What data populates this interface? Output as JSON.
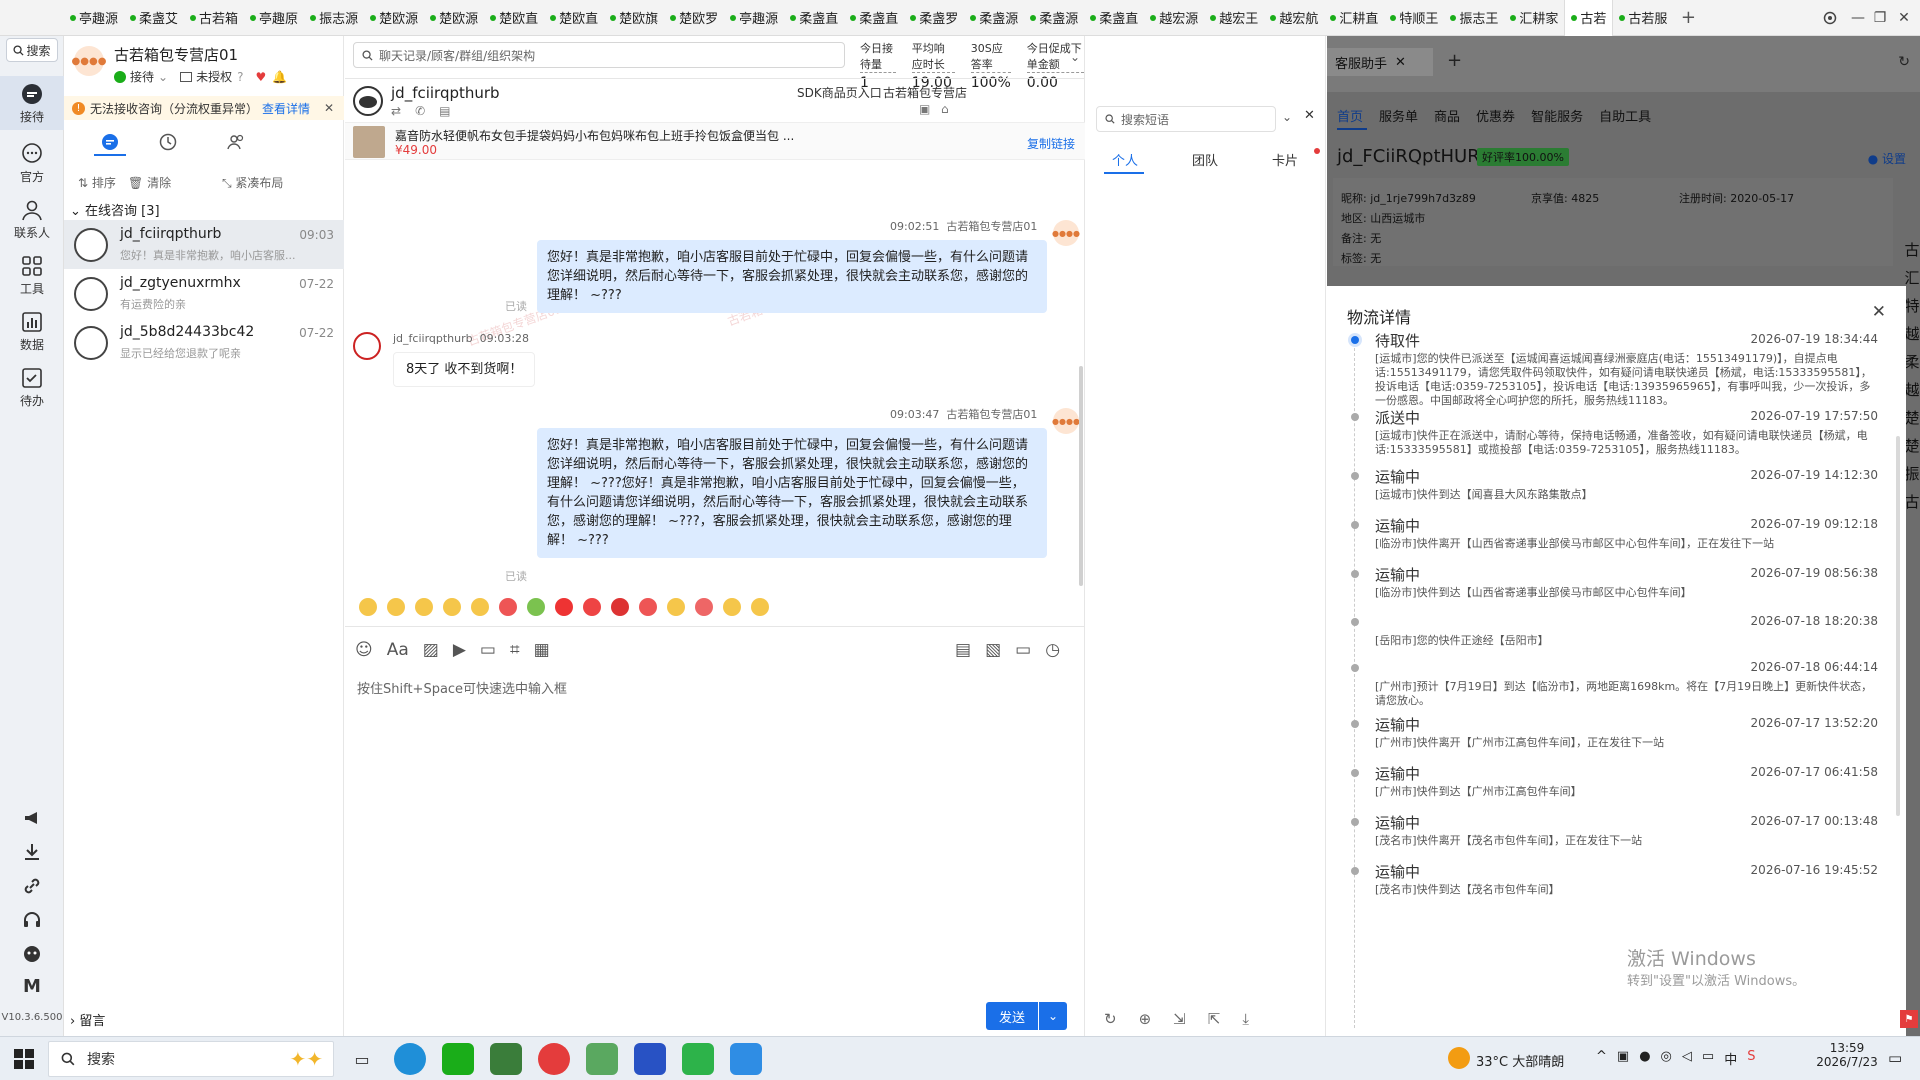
{
  "tabs": [
    "亭趣源",
    "柔盏艾",
    "古若箱",
    "亭趣原",
    "振志源",
    "楚欧源",
    "楚欧源",
    "楚欧直",
    "楚欧直",
    "楚欧旗",
    "楚欧罗",
    "亭趣源",
    "柔盏直",
    "柔盏直",
    "柔盏罗",
    "柔盏源",
    "柔盏源",
    "柔盏直",
    "越宏源",
    "越宏王",
    "越宏航",
    "汇耕直",
    "特顺王",
    "振志王",
    "汇耕家",
    "古若",
    "古若服"
  ],
  "active_tab_index": 25,
  "rail": {
    "search": "搜索",
    "items": [
      "接待",
      "官方",
      "联系人",
      "工具",
      "数据",
      "待办"
    ],
    "version": "V10.3.6.500",
    "bottom_letter": "M"
  },
  "shop": {
    "name": "古若箱包专营店01",
    "status": "接待",
    "auth": "未授权"
  },
  "warning": {
    "text": "无法接收咨询（分流权重异常）",
    "link": "查看详情"
  },
  "conv_toolbar": {
    "sort": "排序",
    "clear": "清除",
    "layout": "紧凑布局"
  },
  "online_header": "在线咨询 [3]",
  "leave_msg": "留言",
  "conversations": [
    {
      "name": "jd_fciirqpthurb",
      "time": "09:03",
      "preview": "您好！真是非常抱歉，咱小店客服..."
    },
    {
      "name": "jd_zgtyenuxrmhx",
      "time": "07-22",
      "preview": "有运费险的亲"
    },
    {
      "name": "jd_5b8d24433bc42",
      "time": "07-22",
      "preview": "显示已经给您退款了呢亲"
    }
  ],
  "chat": {
    "search_placeholder": "聊天记录/顾客/群组/组织架构",
    "stats": [
      {
        "label": "今日接待量",
        "value": "1"
      },
      {
        "label": "平均响应时长",
        "value": "19.00"
      },
      {
        "label": "30S应答率",
        "value": "100%"
      },
      {
        "label": "今日促成下单金额",
        "value": "0.00"
      }
    ],
    "customer": "jd_fciirqpthurb",
    "sdk": "SDK商品页入口",
    "shop": "古若箱包专营店",
    "product_title": "嘉音防水轻便帆布女包手提袋妈妈小布包妈咪布包上班手拎包饭盒便当包 ...",
    "product_price": "¥49.00",
    "copy_link": "复制链接",
    "messages": [
      {
        "from": "shop",
        "time": "09:02:51",
        "sender": "古若箱包专营店01",
        "read": "已读",
        "text": "您好！真是非常抱歉，咱小店客服目前处于忙碌中，回复会偏慢一些，有什么问题请您详细说明，然后耐心等待一下，客服会抓紧处理，很快就会主动联系您，感谢您的理解！ ~???"
      },
      {
        "from": "customer",
        "time": "09:03:28",
        "sender": "jd_fciirqpthurb",
        "text": "8天了  收不到货啊！"
      },
      {
        "from": "shop",
        "time": "09:03:47",
        "sender": "古若箱包专营店01",
        "read": "已读",
        "text": "您好！真是非常抱歉，咱小店客服目前处于忙碌中，回复会偏慢一些，有什么问题请您详细说明，然后耐心等待一下，客服会抓紧处理，很快就会主动联系您，感谢您的理解！ ~???您好！真是非常抱歉，咱小店客服目前处于忙碌中，回复会偏慢一些，有什么问题请您详细说明，然后耐心等待一下，客服会抓紧处理，很快就会主动联系您，感谢您的理解！ ~???，客服会抓紧处理，很快就会主动联系您，感谢您的理解！ ~???"
      }
    ],
    "input_placeholder": "按住Shift+Space可快速选中输入框",
    "send": "发送",
    "watermark": "古若箱包专营店01"
  },
  "phrases": {
    "search_placeholder": "搜索短语",
    "tabs": [
      "个人",
      "团队",
      "卡片"
    ]
  },
  "assistant": {
    "title": "客服助手",
    "nav": [
      "首页",
      "服务单",
      "商品",
      "优惠券",
      "智能服务",
      "自助工具"
    ],
    "customer_id": "jd_FCiiRQptHURb",
    "praise": "好评率100.00%",
    "settings": "设置",
    "info": [
      {
        "label": "昵称:",
        "value": "jd_1rje799h7d3z89"
      },
      {
        "label": "京享值:",
        "value": "4825"
      },
      {
        "label": "注册时间:",
        "value": "2020-05-17"
      },
      {
        "label": "地区:",
        "value": "山西运城市"
      },
      {
        "label": "备注:",
        "value": "无"
      },
      {
        "label": "标签:",
        "value": "无"
      }
    ],
    "right_strip": "古汇特越柔越楚楚振古"
  },
  "logistics": {
    "title": "物流详情",
    "events": [
      {
        "status": "待取件",
        "time": "2026-07-19 18:34:44",
        "text": "[运城市]您的快件已派送至【运城闻喜运城闻喜绿洲豪庭店(电话：15513491179)】，自提点电话:15513491179，请您凭取件码领取快件，如有疑问请电联快递员【杨斌，电话:15333595581】，投诉电话【电话:0359-7253105】，投诉电话【电话:13935965965】，有事呼叫我，少一次投诉，多一份感恩。中国邮政将全心呵护您的所托，服务热线11183。"
      },
      {
        "status": "派送中",
        "time": "2026-07-19 17:57:50",
        "text": "[运城市]快件正在派送中，请耐心等待，保持电话畅通，准备签收，如有疑问请电联快递员【杨斌，电话:15333595581】或揽投部【电话:0359-7253105】，服务热线11183。"
      },
      {
        "status": "运输中",
        "time": "2026-07-19 14:12:30",
        "text": "[运城市]快件到达【闻喜县大风东路集散点】"
      },
      {
        "status": "运输中",
        "time": "2026-07-19 09:12:18",
        "text": "[临汾市]快件离开【山西省寄递事业部侯马市邮区中心包件车间】，正在发往下一站"
      },
      {
        "status": "运输中",
        "time": "2026-07-19 08:56:38",
        "text": "[临汾市]快件到达【山西省寄递事业部侯马市邮区中心包件车间】"
      },
      {
        "status": "",
        "time": "2026-07-18 18:20:38",
        "text": "[岳阳市]您的快件正途经【岳阳市】"
      },
      {
        "status": "",
        "time": "2026-07-18 06:44:14",
        "text": "[广州市]预计【7月19日】到达【临汾市】，两地距离1698km。将在【7月19日晚上】更新快件状态，请您放心。"
      },
      {
        "status": "运输中",
        "time": "2026-07-17 13:52:20",
        "text": "[广州市]快件离开【广州市江高包件车间】，正在发往下一站"
      },
      {
        "status": "运输中",
        "time": "2026-07-17 06:41:58",
        "text": "[广州市]快件到达【广州市江高包件车间】"
      },
      {
        "status": "运输中",
        "time": "2026-07-17 00:13:48",
        "text": "[茂名市]快件离开【茂名市包件车间】，正在发往下一站"
      },
      {
        "status": "运输中",
        "time": "2026-07-16 19:45:52",
        "text": "[茂名市]快件到达【茂名市包件车间】"
      }
    ]
  },
  "activate": {
    "line1": "激活 Windows",
    "line2": "转到\"设置\"以激活 Windows。"
  },
  "taskbar": {
    "search": "搜索",
    "weather": "33°C  大部晴朗",
    "ime": "中",
    "time": "13:59",
    "date": "2026/7/23"
  },
  "colors": {
    "accent": "#1a6fe8",
    "bubble": "#dcebff",
    "rail": "#eef1f5",
    "praise": "#3fae49"
  }
}
